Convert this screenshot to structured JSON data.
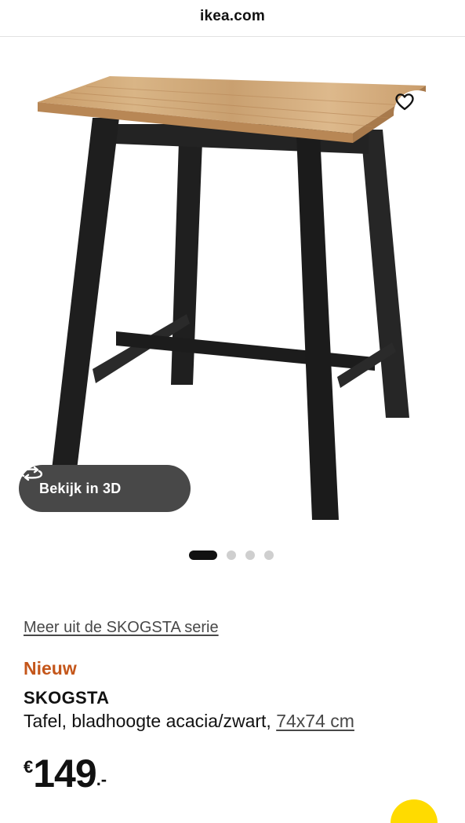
{
  "browser": {
    "url": "ikea.com"
  },
  "gallery": {
    "view_3d_label": "Bekijk in 3D",
    "favorite_icon": "heart-icon",
    "rotate_icon": "rotate-3d-icon",
    "dot_count": 4,
    "active_dot": 0
  },
  "product": {
    "series_link": "Meer uit de SKOGSTA serie",
    "badge": "Nieuw",
    "name": "SKOGSTA",
    "description": "Tafel, bladhoogte acacia/zwart,",
    "dimensions": "74x74 cm",
    "price": {
      "currency": "€",
      "amount": "149",
      "decimals": ".-"
    }
  },
  "colors": {
    "badge": "#c4561a",
    "button_bg": "#484848",
    "accent_yellow": "#ffdb00"
  }
}
